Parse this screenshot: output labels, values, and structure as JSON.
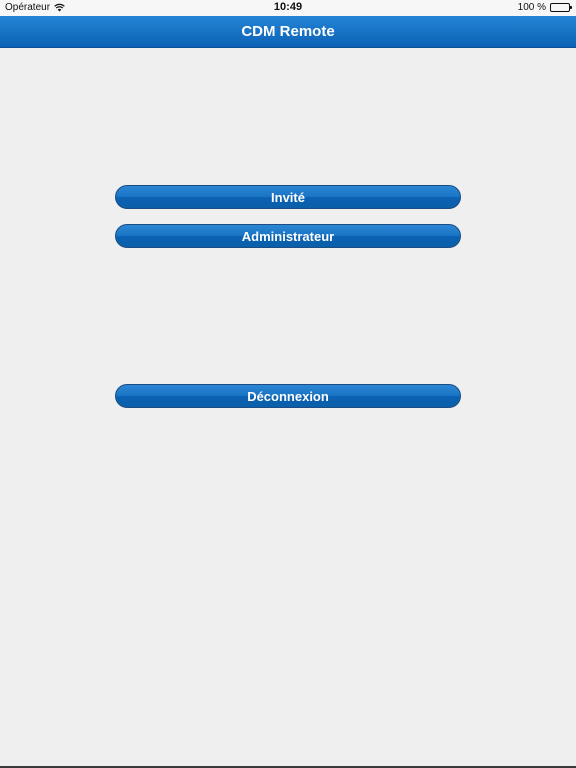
{
  "status_bar": {
    "carrier": "Opérateur",
    "time": "10:49",
    "battery": "100 %"
  },
  "nav": {
    "title": "CDM Remote"
  },
  "buttons": {
    "guest_label": "Invité",
    "admin_label": "Administrateur",
    "logout_label": "Déconnexion"
  },
  "icons": {
    "wifi": "wifi-icon",
    "battery": "battery-icon"
  },
  "colors": {
    "nav_top": "#2584d6",
    "nav_bottom": "#0b62b5",
    "button_blue": "#1a73c4",
    "background": "#efefef"
  }
}
